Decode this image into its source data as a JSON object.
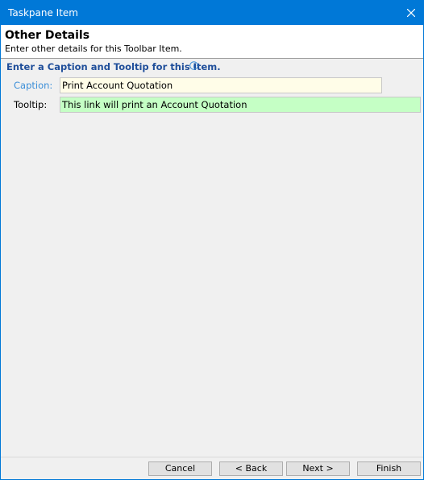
{
  "window": {
    "title": "Taskpane Item"
  },
  "header": {
    "title": "Other Details",
    "subtitle": "Enter other details for this Toolbar Item."
  },
  "section": {
    "heading": "Enter a Caption and Tooltip for this Item.",
    "info_icon": "info-icon"
  },
  "fields": {
    "caption_label": "Caption:",
    "caption_value": "Print Account Quotation",
    "tooltip_label": "Tooltip:",
    "tooltip_value": "This link will print an Account Quotation"
  },
  "buttons": {
    "cancel": "Cancel",
    "back": "< Back",
    "next": "Next >",
    "finish": "Finish"
  },
  "colors": {
    "titlebar": "#0078d7",
    "heading": "#1f4e9a",
    "caption_label": "#3c8fd8",
    "caption_field_bg": "#fffde8",
    "tooltip_field_bg": "#c5ffc5"
  }
}
